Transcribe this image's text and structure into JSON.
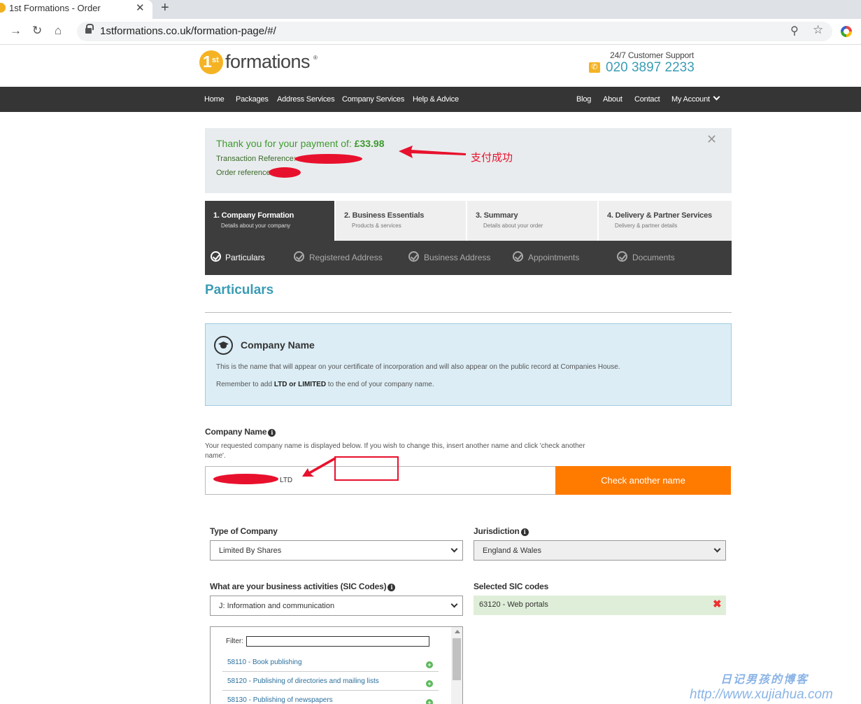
{
  "browser": {
    "tab_title": "1st Formations - Order",
    "tab_close": "✕",
    "new_tab": "+",
    "url": "1stformations.co.uk/formation-page/#/"
  },
  "header": {
    "logo_number": "1",
    "logo_suffix": "st",
    "logo_word": "formations",
    "logo_reg": "®",
    "support_label": "24/7 Customer Support",
    "phone": "020 3897 2233"
  },
  "nav": {
    "left": [
      "Home",
      "Packages",
      "Address Services",
      "Company Services",
      "Help & Advice"
    ],
    "right": [
      "Blog",
      "About",
      "Contact",
      "My Account"
    ]
  },
  "payment": {
    "thanks": "Thank you for your payment of: ",
    "amount": "£33.98",
    "transaction_label": "Transaction Reference:",
    "order_label": "Order reference:",
    "close": "✕"
  },
  "annotation": {
    "text": "支付成功"
  },
  "steps": [
    {
      "title": "1. Company Formation",
      "sub": "Details about your company"
    },
    {
      "title": "2. Business Essentials",
      "sub": "Products & services"
    },
    {
      "title": "3. Summary",
      "sub": "Details about your order"
    },
    {
      "title": "4. Delivery & Partner Services",
      "sub": "Delivery & partner details"
    }
  ],
  "substeps": [
    "Particulars",
    "Registered Address",
    "Business Address",
    "Appointments",
    "Documents"
  ],
  "page_title": "Particulars",
  "infobox": {
    "title": "Company Name",
    "p1": "This is the name that will appear on your certificate of incorporation and will also appear on the public record at Companies House.",
    "p2_pre": "Remember to add ",
    "p2_bold": "LTD or LIMITED",
    "p2_post": " to the end of your company name."
  },
  "company_name": {
    "label": "Company Name",
    "help": "Your requested company name is displayed below. If you wish to change this, insert another name and click 'check another name'.",
    "value": "LTD",
    "button": "Check another name"
  },
  "type_of_company": {
    "label": "Type of Company",
    "value": "Limited By Shares"
  },
  "jurisdiction": {
    "label": "Jurisdiction",
    "value": "England & Wales"
  },
  "sic": {
    "label": "What are your business activities (SIC Codes)",
    "value": "J: Information and communication",
    "selected_label": "Selected SIC codes",
    "selected": [
      "63120 - Web portals"
    ],
    "filter_label": "Filter:",
    "items": [
      "58110 - Book publishing",
      "58120 - Publishing of directories and mailing lists",
      "58130 - Publishing of newspapers"
    ]
  },
  "watermark": {
    "line1": "日记男孩的博客",
    "line2": "http://www.xujiahua.com"
  },
  "colors": {
    "accent": "#3a9cb5",
    "orange": "#ff7b00",
    "nav": "#353535",
    "success": "#3e9a2f",
    "annotation": "#e8112d"
  }
}
